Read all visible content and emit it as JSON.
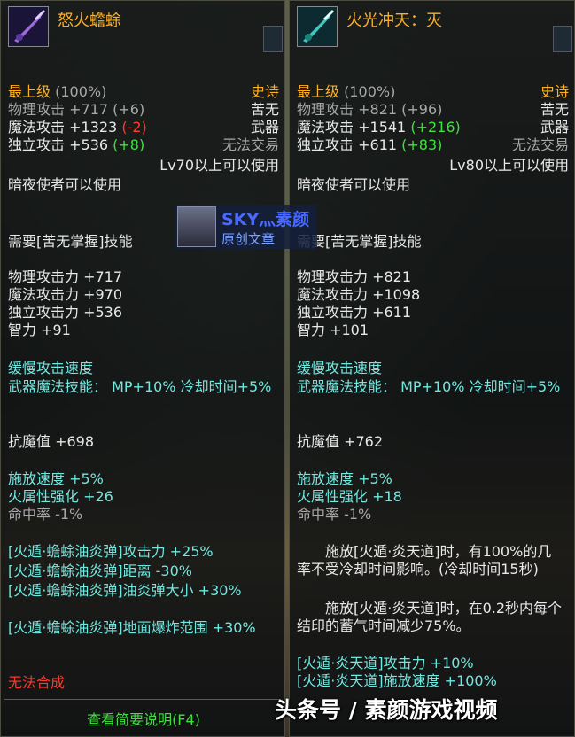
{
  "left": {
    "title": "怒火蟾蜍",
    "grade": "最上级",
    "grade_pct": "(100%)",
    "rarity": "史诗",
    "phys_label": "物理攻击",
    "phys_value": "+717",
    "phys_refine": "(+6)",
    "phys_type": "苦无",
    "magic_label": "魔法攻击",
    "magic_value": "+1323",
    "magic_refine": "(-2)",
    "magic_type": "武器",
    "indep_label": "独立攻击",
    "indep_value": "+536",
    "indep_refine": "(+8)",
    "trade": "无法交易",
    "level_req": "Lv70以上可以使用",
    "class_req": "暗夜使者可以使用",
    "skill_req": "需要[苦无掌握]技能",
    "stats": [
      "物理攻击力 +717",
      "魔法攻击力 +970",
      "独立攻击力 +536",
      "智力 +91"
    ],
    "speed": "缓慢攻击速度",
    "weapon_skill": "武器魔法技能： MP+10% 冷却时间+5%",
    "resist": "抗魔值 +698",
    "bonus1": "施放速度 +5%",
    "bonus2": "火属性强化 +26",
    "hit": "命中率 -1%",
    "skill_lines": [
      "[火遁·蟾蜍油炎弹]攻击力 +25%",
      "[火遁·蟾蜍油炎弹]距离 -30%",
      "[火遁·蟾蜍油炎弹]油炎弹大小 +30%",
      "[火遁·蟾蜍油炎弹]地面爆炸范围 +30%"
    ],
    "cannot_synth": "无法合成",
    "view_desc": "查看简要说明(F4)"
  },
  "right": {
    "title": "火光冲天：灭",
    "grade": "最上级",
    "grade_pct": "(100%)",
    "rarity": "史诗",
    "phys_label": "物理攻击",
    "phys_value": "+821",
    "phys_refine": "(+96)",
    "phys_type": "苦无",
    "magic_label": "魔法攻击",
    "magic_value": "+1541",
    "magic_refine": "(+216)",
    "magic_type": "武器",
    "indep_label": "独立攻击",
    "indep_value": "+611",
    "indep_refine": "(+83)",
    "trade": "无法交易",
    "level_req": "Lv80以上可以使用",
    "class_req": "暗夜使者可以使用",
    "skill_req": "需要[苦无掌握]技能",
    "stats": [
      "物理攻击力 +821",
      "魔法攻击力 +1098",
      "独立攻击力 +611",
      "智力 +101"
    ],
    "speed": "缓慢攻击速度",
    "weapon_skill": "武器魔法技能： MP+10% 冷却时间+5%",
    "resist": "抗魔值 +762",
    "bonus1": "施放速度 +5%",
    "bonus2": "火属性强化 +18",
    "hit": "命中率 -1%",
    "effect1": "施放[火遁·炎天道]时，有100%的几率不受冷却时间影响。(冷却时间15秒)",
    "effect2": "施放[火遁·炎天道]时，在0.2秒内每个结印的蓄气时间减少75%。",
    "skill_lines": [
      "[火遁·炎天道]攻击力 +10%",
      "[火遁·炎天道]施放速度 +100%"
    ]
  },
  "badge": {
    "line1": "SKY灬素颜",
    "line2": "原创文章"
  },
  "watermark": "头条号 / 素颜游戏视频",
  "colors": {
    "title": "#ffb020",
    "stat": "#e8e8e8",
    "skill": "#70e8e0",
    "refine_pos": "#40e040",
    "refine_neg": "#ff3a2a"
  }
}
